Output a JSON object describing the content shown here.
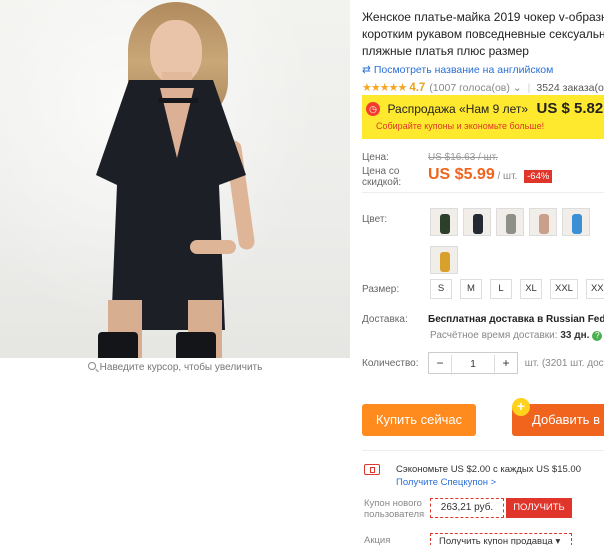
{
  "product": {
    "title_line1": "Женское платье-майка 2019 чокер v-образн",
    "title_line2": "коротким рукавом повседневные сексуальн",
    "title_line3": "пляжные платья плюс размер",
    "translate_link": "Посмотреть название на английском",
    "rating": "4.7",
    "reviews": "(1007 голоса(ов)",
    "orders": "3524 заказа(ов)"
  },
  "image": {
    "zoom_hint": "Наведите курсор, чтобы увеличить"
  },
  "promo": {
    "label": "Распродажа «Нам 9 лет»",
    "price": "US $ 5.82",
    "sub": "Собирайте купоны и экономьте больше!"
  },
  "pricing": {
    "price_label": "Цена:",
    "old_price": "US $16.63 / шт.",
    "discount_price_label_1": "Цена со",
    "discount_price_label_2": "скидкой:",
    "price": "US $5.99",
    "per_unit": "/ шт.",
    "discount": "-64%"
  },
  "color": {
    "label": "Цвет:",
    "swatches": [
      "#2c3f2a",
      "#232833",
      "#8e9087",
      "#caa08c",
      "#3b8fd4",
      "#d8a12c"
    ]
  },
  "size": {
    "label": "Размер:",
    "options": [
      "S",
      "M",
      "L",
      "XL",
      "XXL",
      "XX"
    ]
  },
  "shipping": {
    "label": "Доставка:",
    "main": "Бесплатная доставка в Russian Feder",
    "sub_prefix": "Расчётное время доставки:",
    "days": "33 дн."
  },
  "quantity": {
    "label": "Количество:",
    "minus": "−",
    "value": "1",
    "plus": "+",
    "stock": "шт. (3201 шт. доступ"
  },
  "buttons": {
    "buy": "Купить сейчас",
    "add": "Добавить в",
    "add_badge": "+"
  },
  "coupon": {
    "save_text": "Сэкономьте US $2.00 с каждых US $15.00",
    "get_link": "Получите Спецкупон >",
    "new_user_label": "Купон нового пользователя",
    "amount": "263,21 руб.",
    "get_button": "ПОЛУЧИТЬ",
    "action_label": "Акция",
    "promo_select": "Получить купон продавца ▾"
  },
  "colors": {
    "accent": "#f0641e",
    "promo_bg": "#ffe92e",
    "red": "#e0352a",
    "link": "#2a6fd6"
  }
}
